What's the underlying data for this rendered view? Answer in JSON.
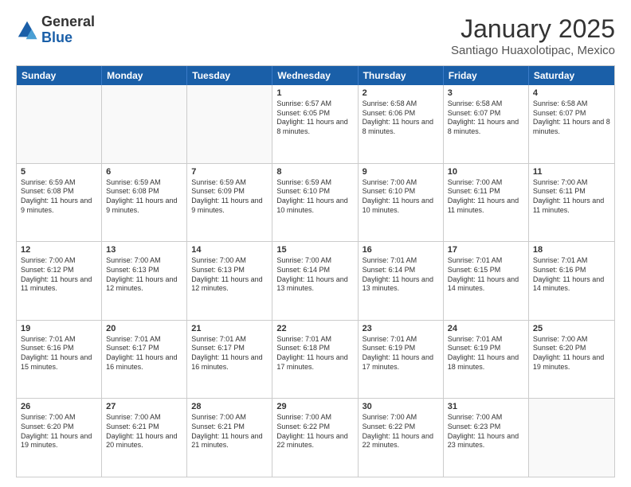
{
  "header": {
    "logo_general": "General",
    "logo_blue": "Blue",
    "month_title": "January 2025",
    "location": "Santiago Huaxolotipac, Mexico"
  },
  "weekdays": [
    "Sunday",
    "Monday",
    "Tuesday",
    "Wednesday",
    "Thursday",
    "Friday",
    "Saturday"
  ],
  "weeks": [
    [
      {
        "day": "",
        "sunrise": "",
        "sunset": "",
        "daylight": "",
        "empty": true
      },
      {
        "day": "",
        "sunrise": "",
        "sunset": "",
        "daylight": "",
        "empty": true
      },
      {
        "day": "",
        "sunrise": "",
        "sunset": "",
        "daylight": "",
        "empty": true
      },
      {
        "day": "1",
        "sunrise": "Sunrise: 6:57 AM",
        "sunset": "Sunset: 6:05 PM",
        "daylight": "Daylight: 11 hours and 8 minutes."
      },
      {
        "day": "2",
        "sunrise": "Sunrise: 6:58 AM",
        "sunset": "Sunset: 6:06 PM",
        "daylight": "Daylight: 11 hours and 8 minutes."
      },
      {
        "day": "3",
        "sunrise": "Sunrise: 6:58 AM",
        "sunset": "Sunset: 6:07 PM",
        "daylight": "Daylight: 11 hours and 8 minutes."
      },
      {
        "day": "4",
        "sunrise": "Sunrise: 6:58 AM",
        "sunset": "Sunset: 6:07 PM",
        "daylight": "Daylight: 11 hours and 8 minutes."
      }
    ],
    [
      {
        "day": "5",
        "sunrise": "Sunrise: 6:59 AM",
        "sunset": "Sunset: 6:08 PM",
        "daylight": "Daylight: 11 hours and 9 minutes."
      },
      {
        "day": "6",
        "sunrise": "Sunrise: 6:59 AM",
        "sunset": "Sunset: 6:08 PM",
        "daylight": "Daylight: 11 hours and 9 minutes."
      },
      {
        "day": "7",
        "sunrise": "Sunrise: 6:59 AM",
        "sunset": "Sunset: 6:09 PM",
        "daylight": "Daylight: 11 hours and 9 minutes."
      },
      {
        "day": "8",
        "sunrise": "Sunrise: 6:59 AM",
        "sunset": "Sunset: 6:10 PM",
        "daylight": "Daylight: 11 hours and 10 minutes."
      },
      {
        "day": "9",
        "sunrise": "Sunrise: 7:00 AM",
        "sunset": "Sunset: 6:10 PM",
        "daylight": "Daylight: 11 hours and 10 minutes."
      },
      {
        "day": "10",
        "sunrise": "Sunrise: 7:00 AM",
        "sunset": "Sunset: 6:11 PM",
        "daylight": "Daylight: 11 hours and 11 minutes."
      },
      {
        "day": "11",
        "sunrise": "Sunrise: 7:00 AM",
        "sunset": "Sunset: 6:11 PM",
        "daylight": "Daylight: 11 hours and 11 minutes."
      }
    ],
    [
      {
        "day": "12",
        "sunrise": "Sunrise: 7:00 AM",
        "sunset": "Sunset: 6:12 PM",
        "daylight": "Daylight: 11 hours and 11 minutes."
      },
      {
        "day": "13",
        "sunrise": "Sunrise: 7:00 AM",
        "sunset": "Sunset: 6:13 PM",
        "daylight": "Daylight: 11 hours and 12 minutes."
      },
      {
        "day": "14",
        "sunrise": "Sunrise: 7:00 AM",
        "sunset": "Sunset: 6:13 PM",
        "daylight": "Daylight: 11 hours and 12 minutes."
      },
      {
        "day": "15",
        "sunrise": "Sunrise: 7:00 AM",
        "sunset": "Sunset: 6:14 PM",
        "daylight": "Daylight: 11 hours and 13 minutes."
      },
      {
        "day": "16",
        "sunrise": "Sunrise: 7:01 AM",
        "sunset": "Sunset: 6:14 PM",
        "daylight": "Daylight: 11 hours and 13 minutes."
      },
      {
        "day": "17",
        "sunrise": "Sunrise: 7:01 AM",
        "sunset": "Sunset: 6:15 PM",
        "daylight": "Daylight: 11 hours and 14 minutes."
      },
      {
        "day": "18",
        "sunrise": "Sunrise: 7:01 AM",
        "sunset": "Sunset: 6:16 PM",
        "daylight": "Daylight: 11 hours and 14 minutes."
      }
    ],
    [
      {
        "day": "19",
        "sunrise": "Sunrise: 7:01 AM",
        "sunset": "Sunset: 6:16 PM",
        "daylight": "Daylight: 11 hours and 15 minutes."
      },
      {
        "day": "20",
        "sunrise": "Sunrise: 7:01 AM",
        "sunset": "Sunset: 6:17 PM",
        "daylight": "Daylight: 11 hours and 16 minutes."
      },
      {
        "day": "21",
        "sunrise": "Sunrise: 7:01 AM",
        "sunset": "Sunset: 6:17 PM",
        "daylight": "Daylight: 11 hours and 16 minutes."
      },
      {
        "day": "22",
        "sunrise": "Sunrise: 7:01 AM",
        "sunset": "Sunset: 6:18 PM",
        "daylight": "Daylight: 11 hours and 17 minutes."
      },
      {
        "day": "23",
        "sunrise": "Sunrise: 7:01 AM",
        "sunset": "Sunset: 6:19 PM",
        "daylight": "Daylight: 11 hours and 17 minutes."
      },
      {
        "day": "24",
        "sunrise": "Sunrise: 7:01 AM",
        "sunset": "Sunset: 6:19 PM",
        "daylight": "Daylight: 11 hours and 18 minutes."
      },
      {
        "day": "25",
        "sunrise": "Sunrise: 7:00 AM",
        "sunset": "Sunset: 6:20 PM",
        "daylight": "Daylight: 11 hours and 19 minutes."
      }
    ],
    [
      {
        "day": "26",
        "sunrise": "Sunrise: 7:00 AM",
        "sunset": "Sunset: 6:20 PM",
        "daylight": "Daylight: 11 hours and 19 minutes."
      },
      {
        "day": "27",
        "sunrise": "Sunrise: 7:00 AM",
        "sunset": "Sunset: 6:21 PM",
        "daylight": "Daylight: 11 hours and 20 minutes."
      },
      {
        "day": "28",
        "sunrise": "Sunrise: 7:00 AM",
        "sunset": "Sunset: 6:21 PM",
        "daylight": "Daylight: 11 hours and 21 minutes."
      },
      {
        "day": "29",
        "sunrise": "Sunrise: 7:00 AM",
        "sunset": "Sunset: 6:22 PM",
        "daylight": "Daylight: 11 hours and 22 minutes."
      },
      {
        "day": "30",
        "sunrise": "Sunrise: 7:00 AM",
        "sunset": "Sunset: 6:22 PM",
        "daylight": "Daylight: 11 hours and 22 minutes."
      },
      {
        "day": "31",
        "sunrise": "Sunrise: 7:00 AM",
        "sunset": "Sunset: 6:23 PM",
        "daylight": "Daylight: 11 hours and 23 minutes."
      },
      {
        "day": "",
        "sunrise": "",
        "sunset": "",
        "daylight": "",
        "empty": true
      }
    ]
  ]
}
